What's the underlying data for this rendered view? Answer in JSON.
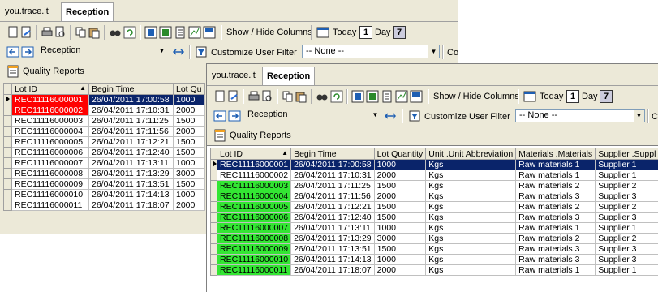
{
  "app_name": "you.trace.it",
  "tab_title": "Reception",
  "toolbar": {
    "show_hide_columns": "Show / Hide Columns",
    "today": "Today",
    "day_badge": "1",
    "day": "Day",
    "week_badge": "7"
  },
  "nav": {
    "combo_value": "Reception",
    "filter_label": "Customize User Filter",
    "filter_value": "-- None --",
    "extra_combo_prefix": "Co"
  },
  "quality_reports": "Quality Reports",
  "columns": [
    "Lot ID",
    "Begin Time",
    "Lot Quantity",
    "Unit .Unit Abbreviation",
    "Materials .Materials",
    "Supplier .Suppl"
  ],
  "back_columns": [
    "Lot ID",
    "Begin Time",
    "Lot Qu"
  ],
  "rows": [
    {
      "lot": "REC11116000001",
      "time": "26/04/2011 17:00:58",
      "qty": "1000",
      "unit": "Kgs",
      "material": "Raw materials 1",
      "supplier": "Supplier 1"
    },
    {
      "lot": "REC11116000002",
      "time": "26/04/2011 17:10:31",
      "qty": "2000",
      "unit": "Kgs",
      "material": "Raw materials 1",
      "supplier": "Supplier 1"
    },
    {
      "lot": "REC11116000003",
      "time": "26/04/2011 17:11:25",
      "qty": "1500",
      "unit": "Kgs",
      "material": "Raw materials 2",
      "supplier": "Supplier 2"
    },
    {
      "lot": "REC11116000004",
      "time": "26/04/2011 17:11:56",
      "qty": "2000",
      "unit": "Kgs",
      "material": "Raw materials 3",
      "supplier": "Supplier 3"
    },
    {
      "lot": "REC11116000005",
      "time": "26/04/2011 17:12:21",
      "qty": "1500",
      "unit": "Kgs",
      "material": "Raw materials 2",
      "supplier": "Supplier 2"
    },
    {
      "lot": "REC11116000006",
      "time": "26/04/2011 17:12:40",
      "qty": "1500",
      "unit": "Kgs",
      "material": "Raw materials 3",
      "supplier": "Supplier 3"
    },
    {
      "lot": "REC11116000007",
      "time": "26/04/2011 17:13:11",
      "qty": "1000",
      "unit": "Kgs",
      "material": "Raw materials 1",
      "supplier": "Supplier 1"
    },
    {
      "lot": "REC11116000008",
      "time": "26/04/2011 17:13:29",
      "qty": "3000",
      "unit": "Kgs",
      "material": "Raw materials 2",
      "supplier": "Supplier 2"
    },
    {
      "lot": "REC11116000009",
      "time": "26/04/2011 17:13:51",
      "qty": "1500",
      "unit": "Kgs",
      "material": "Raw materials 3",
      "supplier": "Supplier 3"
    },
    {
      "lot": "REC11116000010",
      "time": "26/04/2011 17:14:13",
      "qty": "1000",
      "unit": "Kgs",
      "material": "Raw materials 3",
      "supplier": "Supplier 3"
    },
    {
      "lot": "REC11116000011",
      "time": "26/04/2011 17:18:07",
      "qty": "2000",
      "unit": "Kgs",
      "material": "Raw materials 1",
      "supplier": "Supplier 1"
    }
  ],
  "colors": {
    "selected_row": "#0a246a",
    "red_highlight": "#ff0000",
    "green_highlight": "#33e633"
  },
  "back_window_red_rows": [
    0,
    1
  ],
  "front_window_green_rows": [
    2,
    3,
    4,
    5,
    6,
    7,
    8,
    9,
    10
  ],
  "icons": [
    "new-icon",
    "open-icon",
    "print-icon",
    "preview-icon",
    "copy-icon",
    "paste-icon",
    "find-icon",
    "refresh-icon",
    "grid-icon",
    "export-icon",
    "columns-icon",
    "chart-icon",
    "layout-icon",
    "calendar-today-icon",
    "back-icon",
    "forward-icon",
    "filter-icon",
    "report-icon"
  ]
}
